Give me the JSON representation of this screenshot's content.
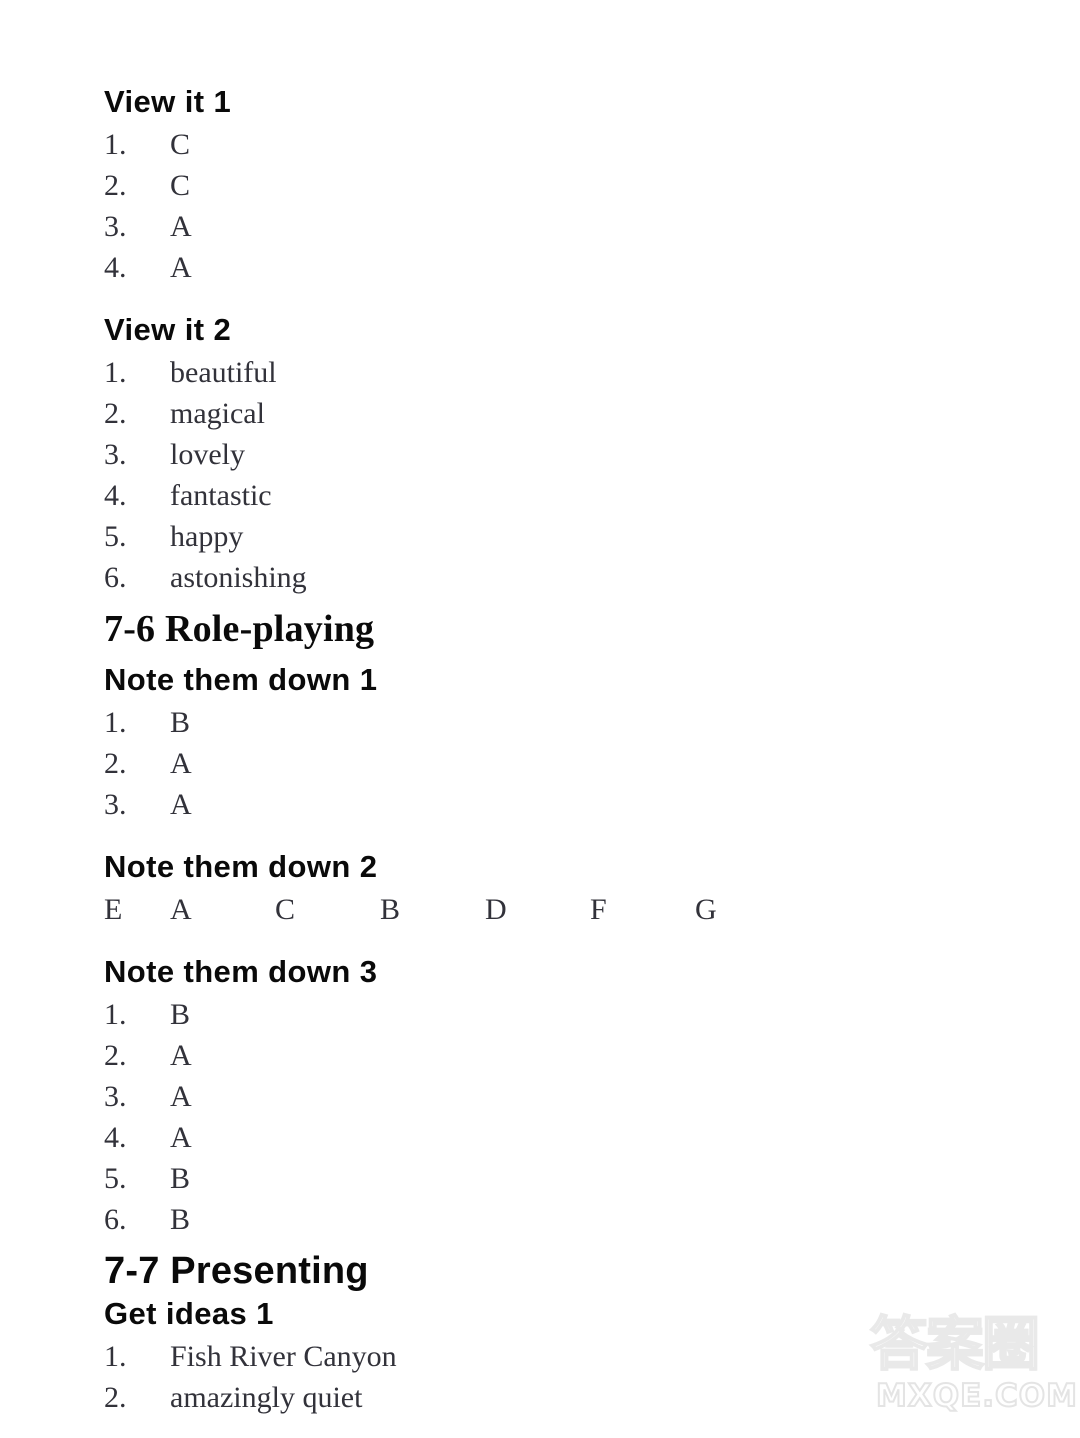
{
  "page": {
    "background_color": "#ffffff",
    "text_color": "#2b2b33"
  },
  "sections": [
    {
      "heading": "View it 1",
      "items": [
        "C",
        "C",
        "A",
        "A"
      ]
    },
    {
      "heading": "View it 2",
      "items": [
        "beautiful",
        "magical",
        "lovely",
        "fantastic",
        "happy",
        "astonishing"
      ]
    },
    {
      "heading": "7-6 Role-playing"
    },
    {
      "heading": "Note them down 1",
      "items": [
        "B",
        "A",
        "A"
      ]
    },
    {
      "heading": "Note them down 2",
      "letters": [
        "E",
        "A",
        "C",
        "B",
        "D",
        "F",
        "G"
      ]
    },
    {
      "heading": "Note them down 3",
      "items": [
        "B",
        "A",
        "A",
        "A",
        "B",
        "B"
      ]
    },
    {
      "heading": "7-7 Presenting"
    },
    {
      "heading": "Get ideas 1",
      "items": [
        "Fish River Canyon",
        "amazingly quiet"
      ]
    }
  ],
  "view_it_1": {
    "heading": "View it 1",
    "numbers": [
      "1.",
      "2.",
      "3.",
      "4."
    ],
    "answers": [
      "C",
      "C",
      "A",
      "A"
    ]
  },
  "view_it_2": {
    "heading": "View it 2",
    "numbers": [
      "1.",
      "2.",
      "3.",
      "4.",
      "5.",
      "6."
    ],
    "answers": [
      "beautiful",
      "magical",
      "lovely",
      "fantastic",
      "happy",
      "astonishing"
    ]
  },
  "unit_7_6": {
    "heading": "7-6 Role-playing"
  },
  "note_them_down_1": {
    "heading": "Note them down 1",
    "numbers": [
      "1.",
      "2.",
      "3."
    ],
    "answers": [
      "B",
      "A",
      "A"
    ]
  },
  "note_them_down_2": {
    "heading": "Note them down 2",
    "letters": [
      "E",
      "A",
      "C",
      "B",
      "D",
      "F",
      "G"
    ]
  },
  "note_them_down_3": {
    "heading": "Note them down 3",
    "numbers": [
      "1.",
      "2.",
      "3.",
      "4.",
      "5.",
      "6."
    ],
    "answers": [
      "B",
      "A",
      "A",
      "A",
      "B",
      "B"
    ]
  },
  "unit_7_7": {
    "heading": "7-7 Presenting"
  },
  "get_ideas_1": {
    "heading": "Get ideas 1",
    "numbers": [
      "1.",
      "2."
    ],
    "answers": [
      "Fish River Canyon",
      "amazingly quiet"
    ]
  },
  "watermark": {
    "cjk_text": "答案圈",
    "domain_text": "MXQE.COM",
    "color": "#e9e9e9"
  }
}
